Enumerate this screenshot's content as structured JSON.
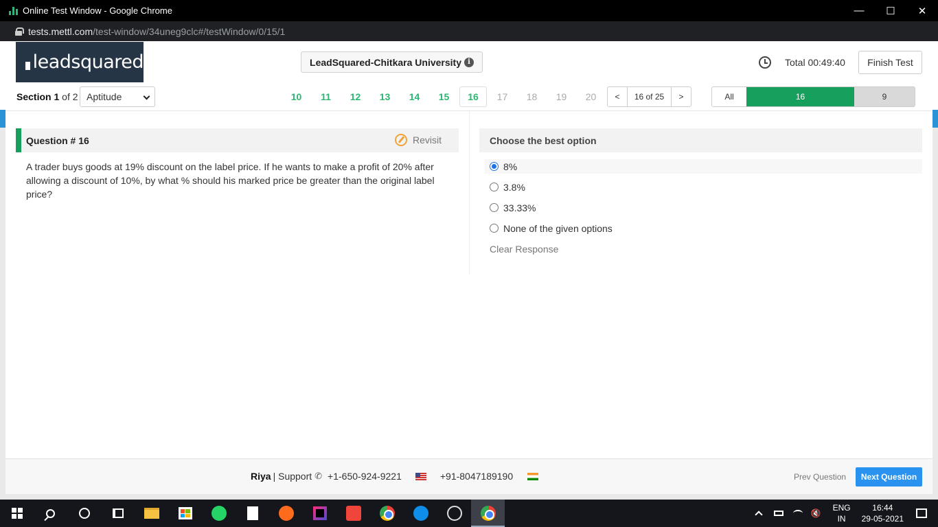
{
  "window": {
    "title": "Online Test Window - Google Chrome",
    "url_domain": "tests.mettl.com",
    "url_path": "/test-window/34uneg9clc#/testWindow/0/15/1"
  },
  "header": {
    "logo_text": "leadsquared",
    "test_name": "LeadSquared-Chitkara University",
    "timer_label": "Total 00:49:40",
    "finish_label": "Finish Test"
  },
  "section": {
    "label_prefix": "Section",
    "number": "1",
    "of_text": "of 2",
    "selected": "Aptitude"
  },
  "question_nav": {
    "numbers": [
      {
        "n": "10",
        "state": "answered"
      },
      {
        "n": "11",
        "state": "answered"
      },
      {
        "n": "12",
        "state": "answered"
      },
      {
        "n": "13",
        "state": "answered"
      },
      {
        "n": "14",
        "state": "answered"
      },
      {
        "n": "15",
        "state": "answered"
      },
      {
        "n": "16",
        "state": "current"
      },
      {
        "n": "17",
        "state": "unvisited"
      },
      {
        "n": "18",
        "state": "unvisited"
      },
      {
        "n": "19",
        "state": "unvisited"
      },
      {
        "n": "20",
        "state": "unvisited"
      }
    ],
    "prev": "<",
    "count": "16 of 25",
    "next": ">"
  },
  "filter": {
    "all": "All",
    "answered": "16",
    "remaining": "9"
  },
  "question": {
    "title": "Question # 16",
    "revisit": "Revisit",
    "text": "A trader buys goods at 19% discount on the label price. If he wants to make a profit of 20% after allowing a discount of 10%, by what % should his marked price be greater than the original label price?"
  },
  "options": {
    "heading": "Choose the best option",
    "items": [
      {
        "label": "8%",
        "selected": true
      },
      {
        "label": "3.8%",
        "selected": false
      },
      {
        "label": "33.33%",
        "selected": false
      },
      {
        "label": "None of the given options",
        "selected": false
      }
    ],
    "clear": "Clear Response"
  },
  "footer": {
    "user": "Riya",
    "support_label": "| Support",
    "phone_us": "+1-650-924-9221",
    "phone_in": "+91-8047189190",
    "prev": "Prev Question",
    "next": "Next Question"
  },
  "taskbar": {
    "lang_top": "ENG",
    "lang_bottom": "IN",
    "time": "16:44",
    "date": "29-05-2021"
  },
  "colors": {
    "accent_green": "#17a05d",
    "nav_green": "#2bb673",
    "logo_bg": "#253545",
    "next_blue": "#2a93f0"
  }
}
